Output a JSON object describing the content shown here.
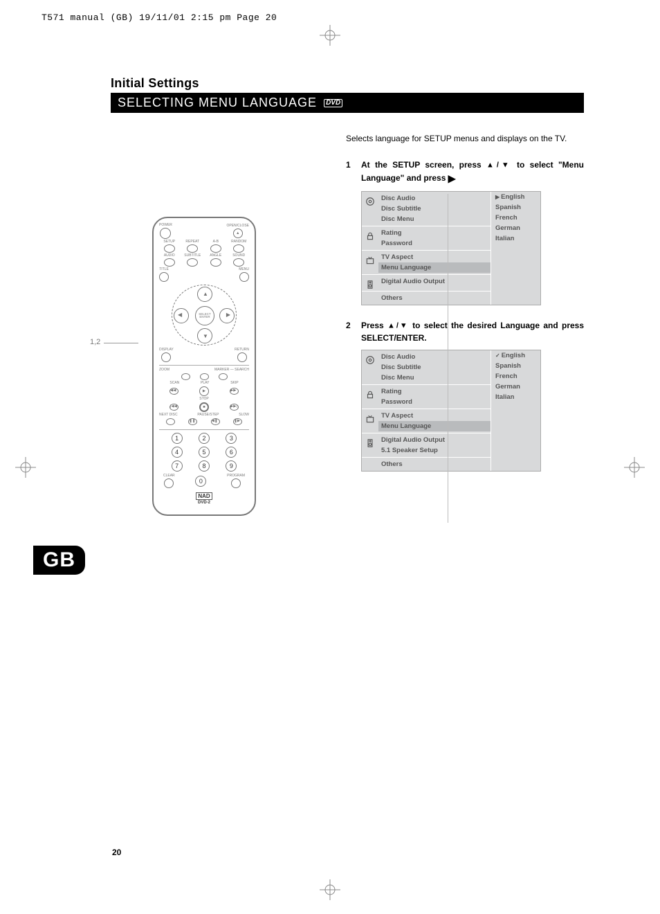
{
  "header_line": "T571 manual (GB)  19/11/01  2:15 pm  Page 20",
  "section_title": "Initial Settings",
  "subsection_title": "SELECTING MENU LANGUAGE",
  "dvd_badge": "DVD",
  "intro_text": "Selects language for SETUP menus and displays on the TV.",
  "steps": [
    {
      "num": "1",
      "body_pre": "At the SETUP screen, press ",
      "arrows": "▲/▼",
      "body_mid": " to select \"Menu Language\" and press ",
      "tail_arrow": "▶"
    },
    {
      "num": "2",
      "body_pre": "Press ",
      "arrows": "▲/▼",
      "body_mid": " to select the desired Language and press SELECT/ENTER.",
      "tail_arrow": ""
    }
  ],
  "menu1": {
    "groups": [
      {
        "icon": "disc",
        "items": [
          "Disc Audio",
          "Disc Subtitle",
          "Disc Menu"
        ]
      },
      {
        "icon": "lock",
        "items": [
          "Rating",
          "Password"
        ]
      },
      {
        "icon": "tv",
        "items": [
          "TV Aspect",
          "Menu Language"
        ],
        "highlight_index": 1
      },
      {
        "icon": "speaker",
        "items": [
          "Digital Audio Output"
        ]
      },
      {
        "icon": "",
        "items": [
          "Others"
        ]
      }
    ],
    "options_marker": "▶",
    "options": [
      "English",
      "Spanish",
      "French",
      "German",
      "Italian"
    ]
  },
  "menu2": {
    "groups": [
      {
        "icon": "disc",
        "items": [
          "Disc Audio",
          "Disc Subtitle",
          "Disc Menu"
        ]
      },
      {
        "icon": "lock",
        "items": [
          "Rating",
          "Password"
        ]
      },
      {
        "icon": "tv",
        "items": [
          "TV Aspect",
          "Menu Language"
        ],
        "highlight_index": 1
      },
      {
        "icon": "speaker",
        "items": [
          "Digital Audio Output",
          "5.1 Speaker Setup"
        ]
      },
      {
        "icon": "",
        "items": [
          "Others"
        ]
      }
    ],
    "options_marker": "✓",
    "options": [
      "English",
      "Spanish",
      "French",
      "German",
      "Italian"
    ]
  },
  "remote": {
    "ref_label": "1,2",
    "power": "POWER",
    "openclose": "OPEN/CLOSE",
    "row2": [
      "SETUP",
      "REPEAT",
      "A-B",
      "RANDOM"
    ],
    "row3": [
      "AUDIO",
      "SUBTITLE",
      "ANGLE",
      "SOUND"
    ],
    "title": "TITLE",
    "menu": "MENU",
    "select_enter": "SELECT ENTER",
    "display": "DISPLAY",
    "return": "RETURN",
    "zoom": "ZOOM",
    "marker_search": "MARKER — SEARCH",
    "scan": "SCAN",
    "play": "PLAY",
    "skip": "SKIP",
    "stop": "STOP",
    "nextdisc": "NEXT DISC",
    "pausestep": "PAUSE/STEP",
    "slow": "SLOW",
    "numbers": [
      "1",
      "2",
      "3",
      "4",
      "5",
      "6",
      "7",
      "8",
      "9",
      "0"
    ],
    "clear": "CLEAR",
    "program": "PROGRAM",
    "brand": "NAD",
    "model": "DVD-2"
  },
  "gb_tab": "GB",
  "page_number": "20"
}
